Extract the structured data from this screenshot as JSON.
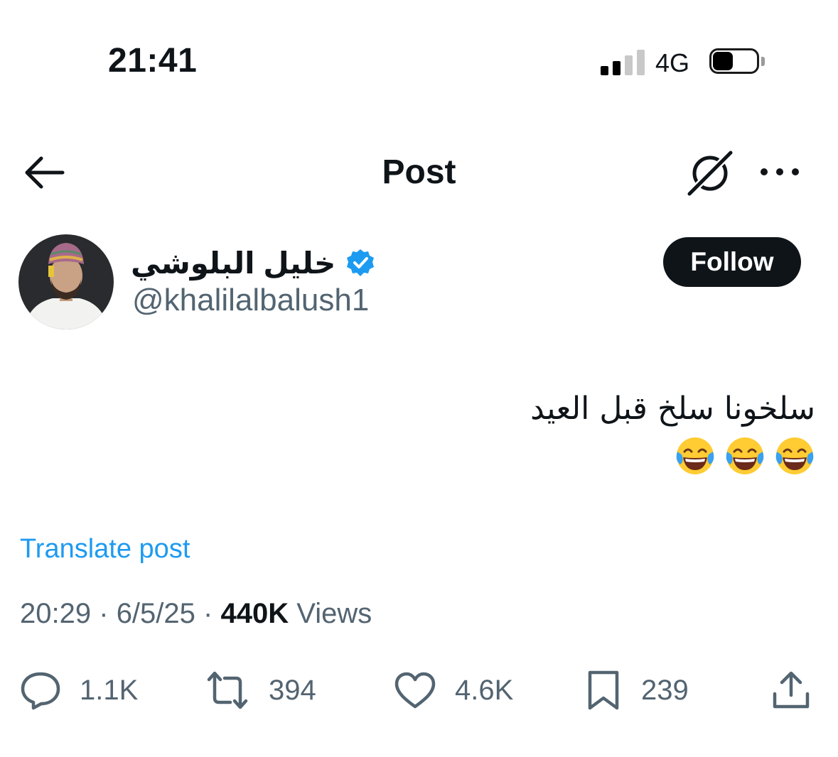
{
  "status_bar": {
    "time": "21:41",
    "network": "4G",
    "signal_bars_active": 2,
    "signal_bars_total": 4
  },
  "nav": {
    "title": "Post",
    "back_icon": "arrow-left-icon",
    "grok_icon": "grok-icon",
    "more_icon": "more-horizontal-icon"
  },
  "author": {
    "name": "خليل البلوشي",
    "handle": "@khalilalbalush1",
    "verified": true,
    "follow_label": "Follow"
  },
  "post": {
    "text": "سلخونا سلخ قبل العيد",
    "emojis": [
      "😂",
      "😂",
      "😂"
    ],
    "translate_label": "Translate post",
    "time": "20:29",
    "date": "6/5/25",
    "views": "440K",
    "views_label": "Views",
    "separator": "·"
  },
  "actions": {
    "replies": "1.1K",
    "reposts": "394",
    "likes": "4.6K",
    "bookmarks": "239"
  },
  "colors": {
    "accent": "#1d9bf0",
    "text": "#0f1419",
    "secondary": "#536471",
    "button_bg": "#0f1419"
  }
}
